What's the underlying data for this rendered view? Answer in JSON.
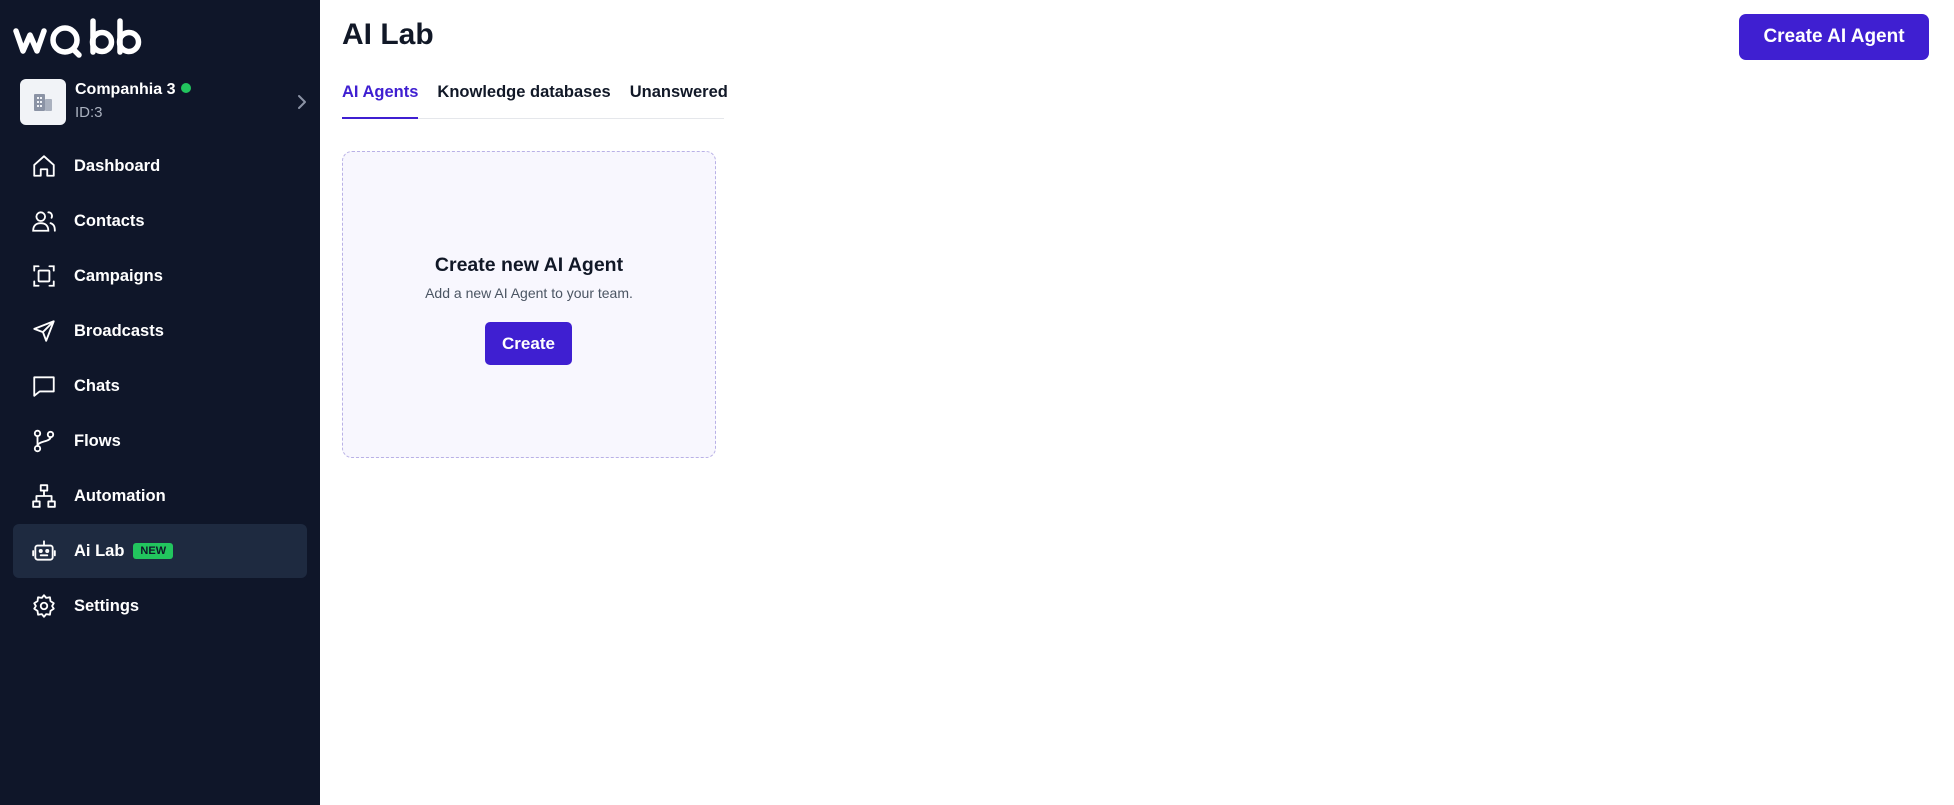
{
  "brand": {
    "logo_text": "wabb"
  },
  "company": {
    "name": "Companhia 3",
    "id": "ID:3",
    "status_color": "#22c55e"
  },
  "sidebar": {
    "items": [
      {
        "label": "Dashboard",
        "icon": "home-icon"
      },
      {
        "label": "Contacts",
        "icon": "users-icon"
      },
      {
        "label": "Campaigns",
        "icon": "campaign-icon"
      },
      {
        "label": "Broadcasts",
        "icon": "send-icon"
      },
      {
        "label": "Chats",
        "icon": "chat-icon"
      },
      {
        "label": "Flows",
        "icon": "git-branch-icon"
      },
      {
        "label": "Automation",
        "icon": "sitemap-icon"
      },
      {
        "label": "Ai Lab",
        "icon": "robot-icon",
        "badge": "NEW",
        "active": true
      },
      {
        "label": "Settings",
        "icon": "gear-icon"
      }
    ]
  },
  "header": {
    "title": "AI Lab",
    "create_button": "Create AI Agent"
  },
  "tabs": [
    {
      "label": "AI Agents",
      "active": true
    },
    {
      "label": "Knowledge databases"
    },
    {
      "label": "Unanswered"
    }
  ],
  "empty_card": {
    "title": "Create new AI Agent",
    "subtitle": "Add a new AI Agent to your team.",
    "button": "Create"
  },
  "colors": {
    "sidebar_bg": "#0f1629",
    "accent": "#3f1fd1",
    "badge": "#22c55e"
  }
}
